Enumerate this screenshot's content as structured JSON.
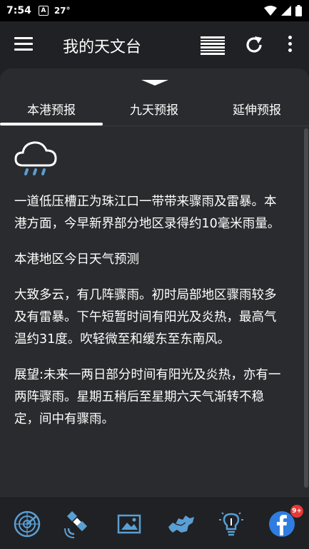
{
  "status_bar": {
    "time": "7:54",
    "notification_letter": "A",
    "temperature": "27°"
  },
  "app_bar": {
    "title": "我的天文台"
  },
  "tabs": [
    {
      "label": "本港预报",
      "selected": true
    },
    {
      "label": "九天预报",
      "selected": false
    },
    {
      "label": "延伸预报",
      "selected": false
    }
  ],
  "forecast": {
    "icon": "rain-cloud-icon",
    "paragraphs": [
      "一道低压槽正为珠江口一带带来骤雨及雷暴。本港方面，今早新界部分地区录得约10毫米雨量。",
      "本港地区今日天气预测",
      "大致多云，有几阵骤雨。初时局部地区骤雨较多及有雷暴。下午短暂时间有阳光及炎热，最高气温约31度。吹轻微至和缓东至东南风。",
      "展望:未来一两日部分时间有阳光及炎热，亦有一两阵骤雨。星期五稍后至星期六天气渐转不稳定，间中有骤雨。"
    ]
  },
  "bottom_nav": {
    "items": [
      "radar-icon",
      "satellite-icon",
      "photos-icon",
      "map-icon",
      "lightbulb-icon",
      "facebook-icon"
    ],
    "facebook_badge": "9+"
  },
  "colors": {
    "background": "#202124",
    "sheet": "#2a2b2e",
    "icon_blue": "#5a9fd4",
    "badge": "#e53935"
  }
}
